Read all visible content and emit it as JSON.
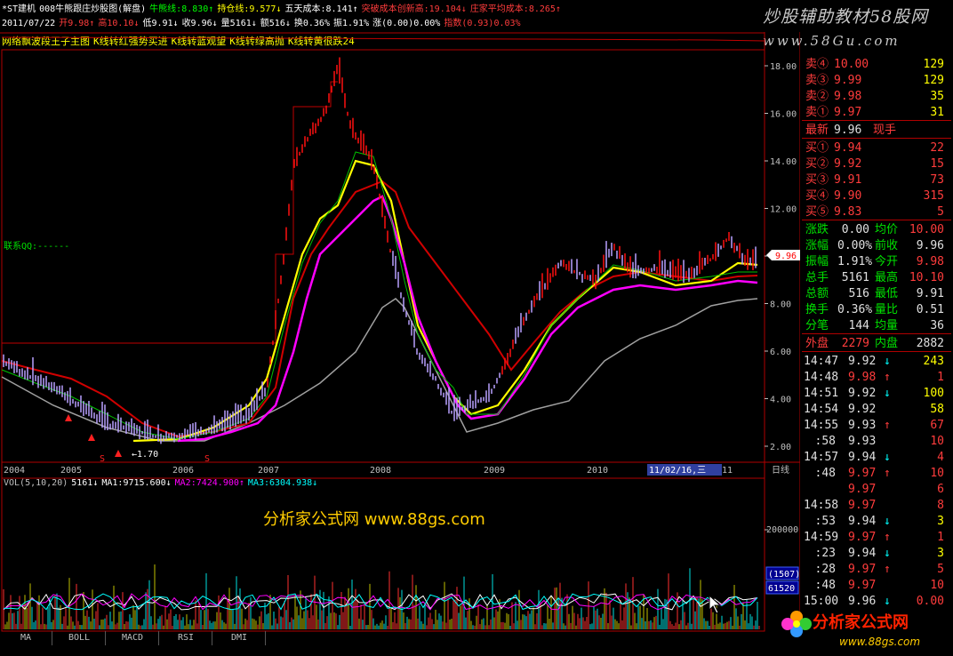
{
  "header": {
    "line1": [
      {
        "text": "*ST建机",
        "color": "#ffffff"
      },
      {
        "text": "008牛熊跟庄炒股图(解盘)",
        "color": "#ffffff"
      },
      {
        "text": "牛熊线:8.830↑",
        "color": "#00ff00"
      },
      {
        "text": "持仓线:9.577↓",
        "color": "#ffff00"
      },
      {
        "text": "五天成本:8.141↑",
        "color": "#ffffff"
      },
      {
        "text": "突破成本创新高:19.104↓",
        "color": "#ff3c3c"
      },
      {
        "text": "庄家平均成本:8.265↑",
        "color": "#ff3c3c"
      }
    ],
    "line2": [
      {
        "text": "2011/07/22",
        "color": "#ffffff"
      },
      {
        "text": "开9.98↑",
        "color": "#ff3c3c"
      },
      {
        "text": "高10.10↓",
        "color": "#ff3c3c"
      },
      {
        "text": "低9.91↓",
        "color": "#ffffff"
      },
      {
        "text": "收9.96↓",
        "color": "#ffffff"
      },
      {
        "text": "量5161↓",
        "color": "#ffffff"
      },
      {
        "text": "额516↓",
        "color": "#ffffff"
      },
      {
        "text": "换0.36%",
        "color": "#ffffff"
      },
      {
        "text": "振1.91%",
        "color": "#ffffff"
      },
      {
        "text": "涨(0.00)0.00%",
        "color": "#ffffff"
      },
      {
        "text": "指数(0.93)0.03%",
        "color": "#ff3c3c"
      }
    ]
  },
  "indicator_row": [
    "网络飘波段王子主图",
    "K线转红强势买进",
    "K线转蓝观望",
    "K线转绿高抛",
    "K线转黄很跌24"
  ],
  "contact_label": "联系QQ:------",
  "watermark": {
    "line1": "炒股辅助教材58股网",
    "line2": "www.58Gu.com"
  },
  "price_axis": [
    "18.00",
    "16.00",
    "14.00",
    "12.00",
    "10.00",
    "8.00",
    "6.00",
    "4.00",
    "2.00"
  ],
  "current_price_tag": "9.96",
  "low_marker": "1.70",
  "date_axis": [
    "2004",
    "2005",
    "2006",
    "2007",
    "2008",
    "2009",
    "2010",
    "11",
    "日线"
  ],
  "cursor_date": "11/02/16,三",
  "volume": {
    "legend": [
      {
        "text": "VOL(5,10,20)",
        "color": "#c0c0c0"
      },
      {
        "text": "5161↓",
        "color": "#ffffff"
      },
      {
        "text": "MA1:9715.600↓",
        "color": "#ffffff"
      },
      {
        "text": "MA2:7424.900↑",
        "color": "#ff00ff"
      },
      {
        "text": "MA3:6304.938↓",
        "color": "#00ffff"
      }
    ],
    "axis_label": "200000",
    "box1": "(1507)",
    "box2": "61520"
  },
  "site_watermark": "分析家公式网 www.88gs.com",
  "quotes": {
    "sell": [
      {
        "label": "卖④",
        "price": "10.00",
        "vol": "129"
      },
      {
        "label": "卖③",
        "price": "9.99",
        "vol": "129"
      },
      {
        "label": "卖②",
        "price": "9.98",
        "vol": "35"
      },
      {
        "label": "卖①",
        "price": "9.97",
        "vol": "31"
      }
    ],
    "latest_label": "最新",
    "latest_price": "9.96",
    "latest_unit": "现手",
    "buy": [
      {
        "label": "买①",
        "price": "9.94",
        "vol": "22"
      },
      {
        "label": "买②",
        "price": "9.92",
        "vol": "15"
      },
      {
        "label": "买③",
        "price": "9.91",
        "vol": "73"
      },
      {
        "label": "买④",
        "price": "9.90",
        "vol": "315"
      },
      {
        "label": "买⑤",
        "price": "9.83",
        "vol": "5"
      }
    ],
    "stats": [
      {
        "l1": "涨跌",
        "v1": "0.00",
        "l2": "均价",
        "v2": "10.00",
        "c2": "#ff3c3c"
      },
      {
        "l1": "涨幅",
        "v1": "0.00%",
        "l2": "前收",
        "v2": "9.96",
        "c2": "#e0e0e0"
      },
      {
        "l1": "振幅",
        "v1": "1.91%",
        "l2": "今开",
        "v2": "9.98",
        "c2": "#ff3c3c"
      },
      {
        "l1": "总手",
        "v1": "5161",
        "l2": "最高",
        "v2": "10.10",
        "c2": "#ff3c3c"
      },
      {
        "l1": "总额",
        "v1": "516",
        "l2": "最低",
        "v2": "9.91",
        "c2": "#e0e0e0"
      },
      {
        "l1": "换手",
        "v1": "0.36%",
        "l2": "量比",
        "v2": "0.51",
        "c2": "#e0e0e0"
      },
      {
        "l1": "分笔",
        "v1": "144",
        "l2": "均量",
        "v2": "36",
        "c2": "#e0e0e0"
      }
    ],
    "outer_label": "外盘",
    "outer_val": "2279",
    "inner_label": "内盘",
    "inner_val": "2882",
    "ticks": [
      {
        "t": "14:47",
        "p": "9.92",
        "a": "↓",
        "v": "243",
        "pc": "#e0e0e0",
        "vc": "#ffff00",
        "ac": "#00ffff"
      },
      {
        "t": "14:48",
        "p": "9.98",
        "a": "↑",
        "v": "1",
        "pc": "#ff3c3c",
        "vc": "#ff3c3c",
        "ac": "#ff3c3c"
      },
      {
        "t": "14:51",
        "p": "9.92",
        "a": "↓",
        "v": "100",
        "pc": "#e0e0e0",
        "vc": "#ffff00",
        "ac": "#00ffff"
      },
      {
        "t": "14:54",
        "p": "9.92",
        "a": "",
        "v": "58",
        "pc": "#e0e0e0",
        "vc": "#ffff00",
        "ac": "#00ffff"
      },
      {
        "t": "14:55",
        "p": "9.93",
        "a": "↑",
        "v": "67",
        "pc": "#e0e0e0",
        "vc": "#ff3c3c",
        "ac": "#ff3c3c"
      },
      {
        "t": ":58",
        "p": "9.93",
        "a": "",
        "v": "10",
        "pc": "#e0e0e0",
        "vc": "#ff3c3c",
        "ac": "#ff3c3c"
      },
      {
        "t": "14:57",
        "p": "9.94",
        "a": "↓",
        "v": "4",
        "pc": "#e0e0e0",
        "vc": "#ff3c3c",
        "ac": "#00ffff"
      },
      {
        "t": ":48",
        "p": "9.97",
        "a": "↑",
        "v": "10",
        "pc": "#ff3c3c",
        "vc": "#ff3c3c",
        "ac": "#ff3c3c"
      },
      {
        "t": "",
        "p": "9.97",
        "a": "",
        "v": "6",
        "pc": "#ff3c3c",
        "vc": "#ff3c3c",
        "ac": "#ff3c3c"
      },
      {
        "t": "14:58",
        "p": "9.97",
        "a": "",
        "v": "8",
        "pc": "#ff3c3c",
        "vc": "#ff3c3c",
        "ac": "#ff3c3c"
      },
      {
        "t": ":53",
        "p": "9.94",
        "a": "↓",
        "v": "3",
        "pc": "#e0e0e0",
        "vc": "#ffff00",
        "ac": "#00ffff"
      },
      {
        "t": "14:59",
        "p": "9.97",
        "a": "↑",
        "v": "1",
        "pc": "#ff3c3c",
        "vc": "#ff3c3c",
        "ac": "#ff3c3c"
      },
      {
        "t": ":23",
        "p": "9.94",
        "a": "↓",
        "v": "3",
        "pc": "#e0e0e0",
        "vc": "#ffff00",
        "ac": "#00ffff"
      },
      {
        "t": ":28",
        "p": "9.97",
        "a": "↑",
        "v": "5",
        "pc": "#ff3c3c",
        "vc": "#ff3c3c",
        "ac": "#ff3c3c"
      },
      {
        "t": ":48",
        "p": "9.97",
        "a": "",
        "v": "10",
        "pc": "#ff3c3c",
        "vc": "#ff3c3c",
        "ac": "#ff3c3c"
      },
      {
        "t": "15:00",
        "p": "9.96",
        "a": "↓",
        "v": "0.00",
        "pc": "#e0e0e0",
        "vc": "#ff3c3c",
        "ac": "#00ffff"
      }
    ]
  },
  "tabs": [
    "MA",
    "BOLL",
    "MACD",
    "RSI",
    "DMI"
  ],
  "logo": {
    "text": "分析家公式网",
    "url": "www.88gs.com"
  }
}
